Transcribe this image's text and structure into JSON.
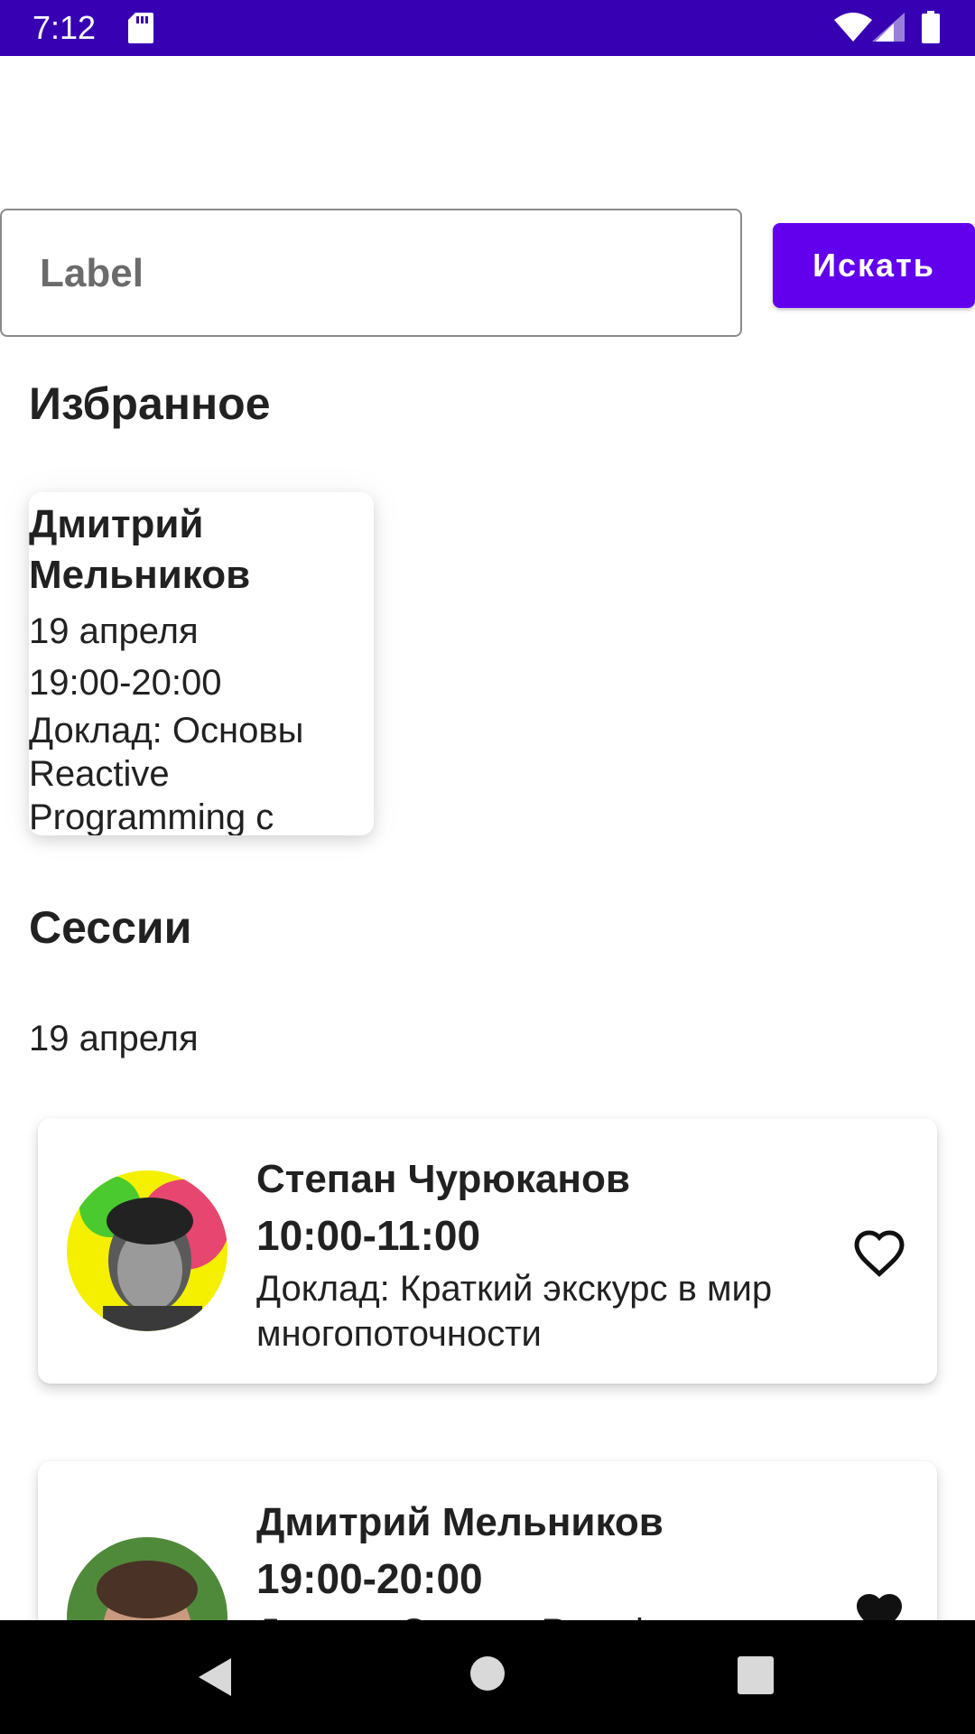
{
  "status_bar": {
    "time": "7:12",
    "icons": [
      "sd-card-icon",
      "wifi-icon",
      "signal-icon",
      "battery-icon"
    ],
    "background": "#3700b3"
  },
  "search": {
    "placeholder": "Label",
    "value": "",
    "button_label": "Искать",
    "button_color": "#6200ee"
  },
  "favorites": {
    "title": "Избранное",
    "items": [
      {
        "name": "Дмитрий Мельников",
        "date": "19 апреля",
        "time": "19:00-20:00",
        "talk": "Доклад: Основы Reactive Programming с"
      }
    ]
  },
  "sessions": {
    "title": "Сессии",
    "day": "19 апреля",
    "items": [
      {
        "name": "Степан Чурюканов",
        "time": "10:00-11:00",
        "talk": "Доклад: Краткий экскурс в мир многопоточности",
        "favorite": false,
        "avatar": "speaker-photo"
      },
      {
        "name": "Дмитрий Мельников",
        "time": "19:00-20:00",
        "talk": "Доклад: Основы Reactive",
        "favorite": true,
        "avatar": "speaker-photo"
      }
    ]
  },
  "nav_bar": {
    "icons": [
      "back-icon",
      "home-icon",
      "recents-icon"
    ]
  }
}
